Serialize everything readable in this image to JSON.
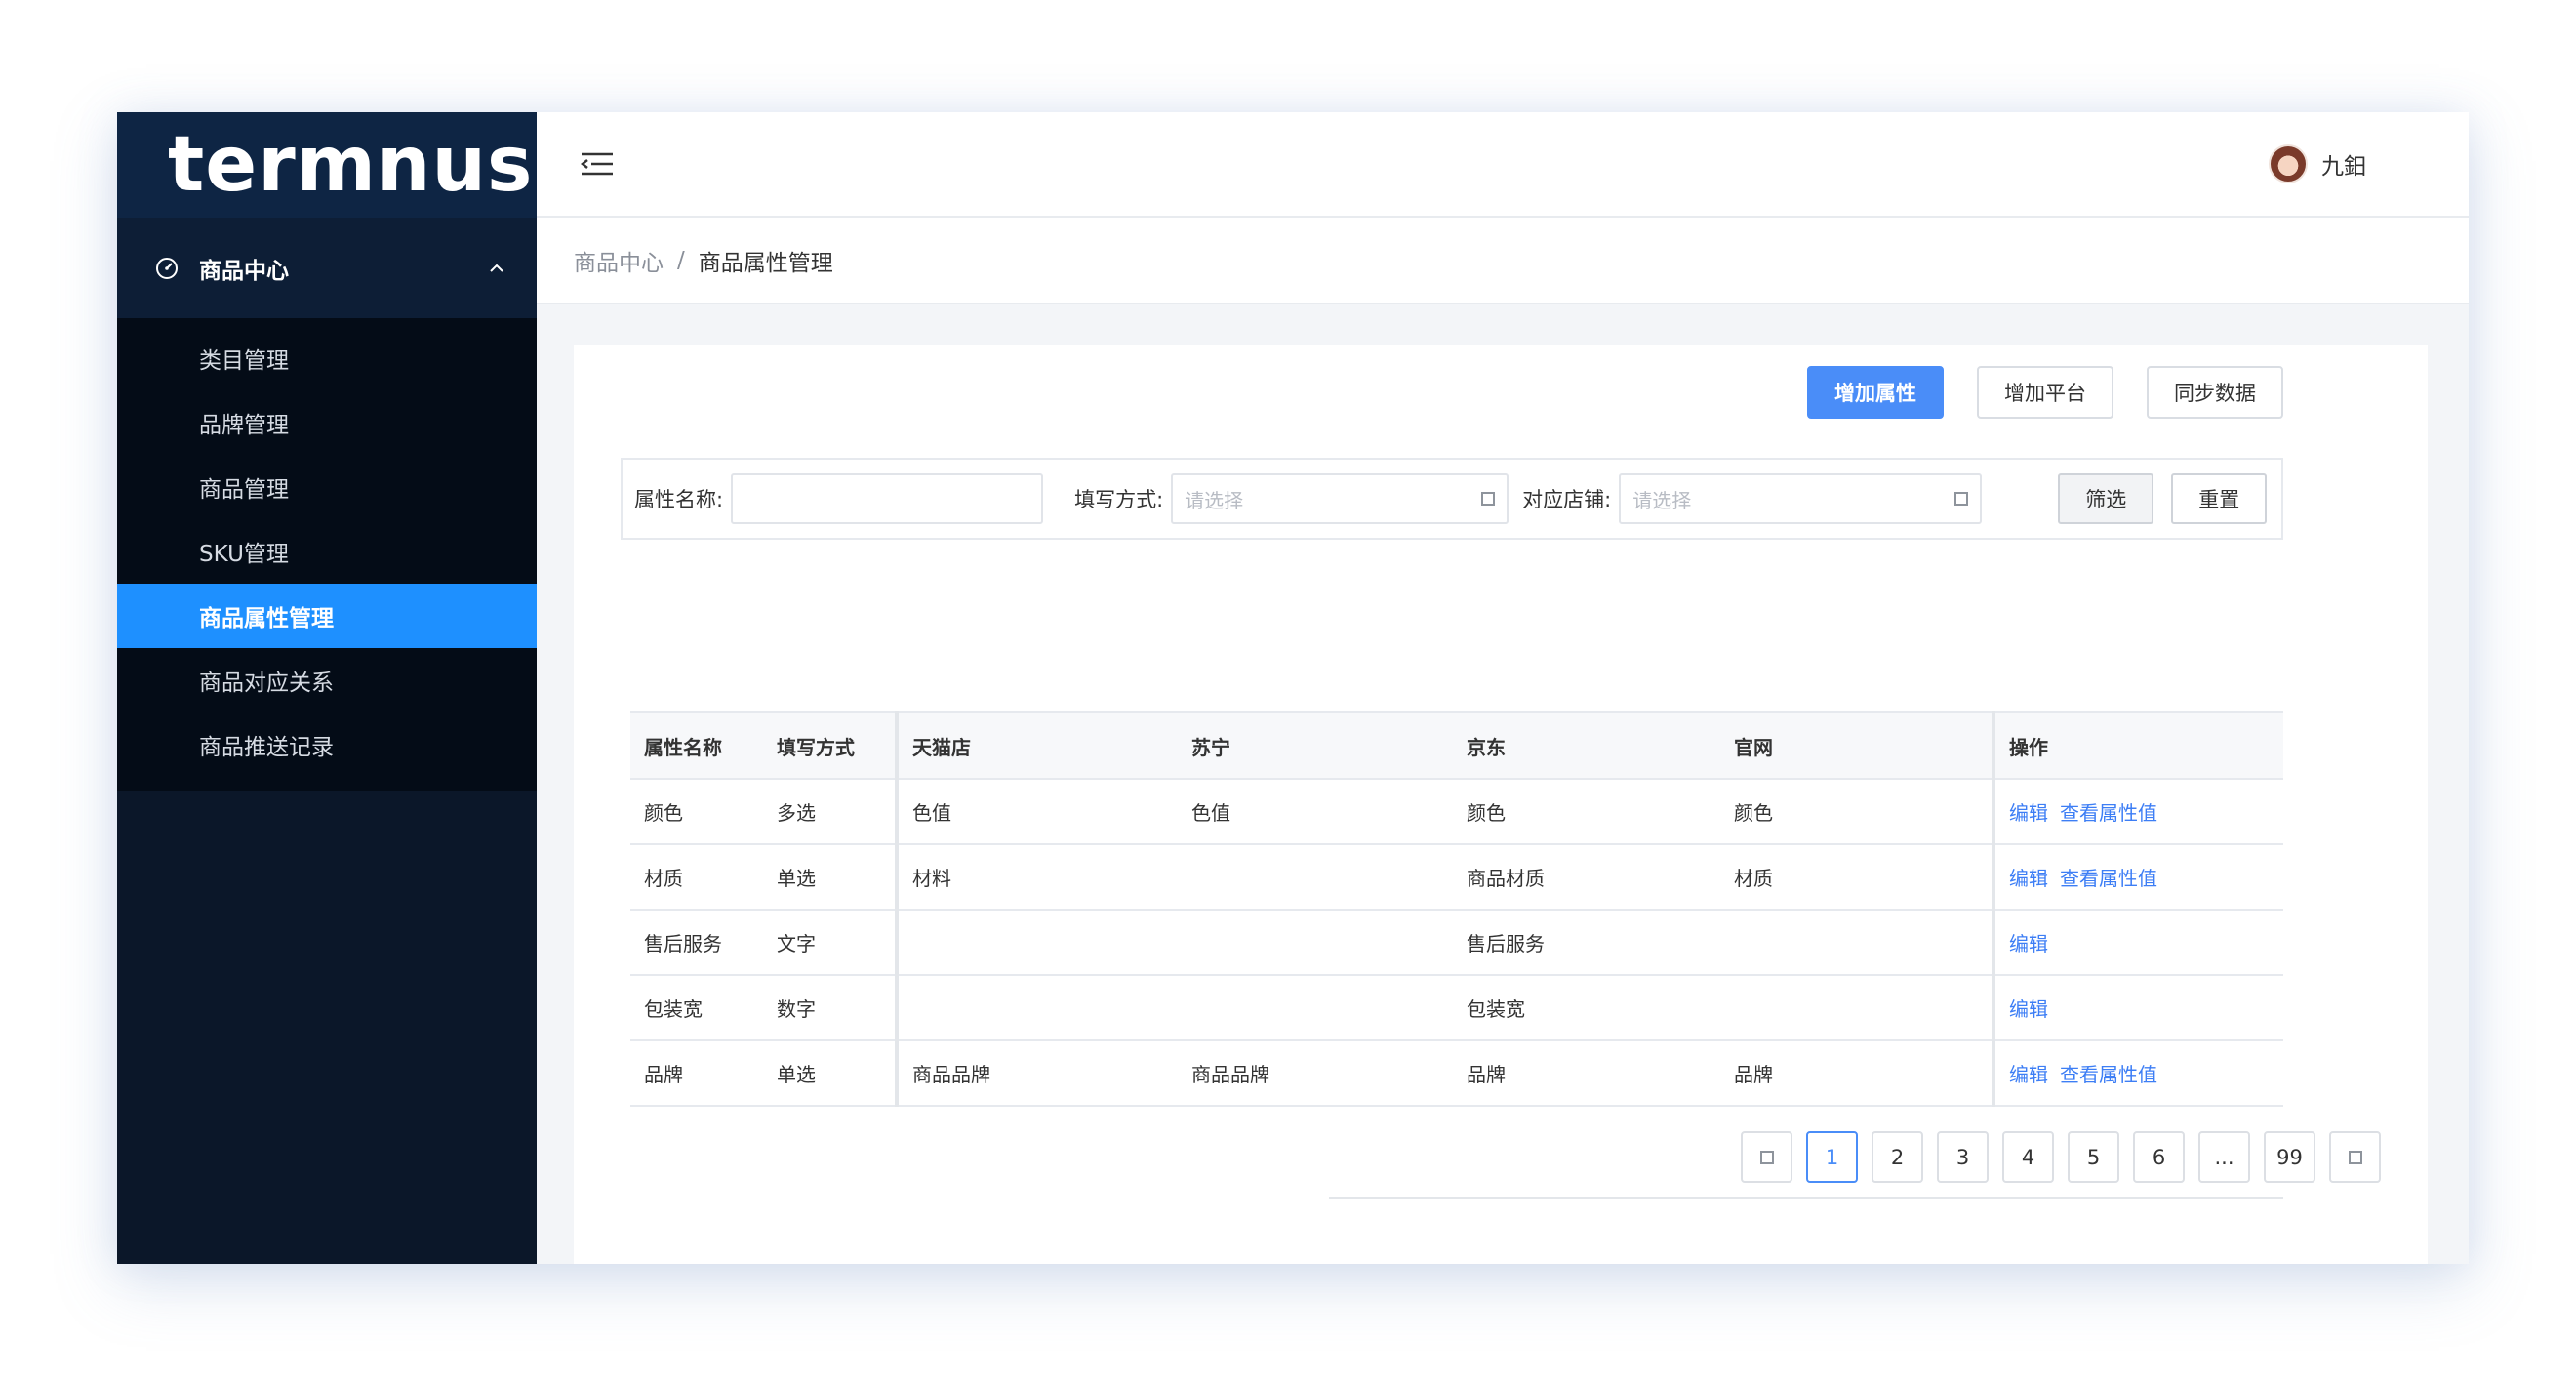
{
  "app": {
    "logo_text": "termnus"
  },
  "sidebar": {
    "group_label": "商品中心",
    "items": [
      {
        "label": "类目管理"
      },
      {
        "label": "品牌管理"
      },
      {
        "label": "商品管理"
      },
      {
        "label": "SKU管理"
      },
      {
        "label": "商品属性管理"
      },
      {
        "label": "商品对应关系"
      },
      {
        "label": "商品推送记录"
      }
    ],
    "active_index": 4
  },
  "header": {
    "user_name": "九鈤"
  },
  "breadcrumb": {
    "parent": "商品中心",
    "separator": "/",
    "current": "商品属性管理"
  },
  "toolbar": {
    "add_attr": "增加属性",
    "add_platform": "增加平台",
    "sync_data": "同步数据"
  },
  "filter": {
    "name_label": "属性名称:",
    "name_value": "",
    "method_label": "填写方式:",
    "method_placeholder": "请选择",
    "store_label": "对应店铺:",
    "store_placeholder": "请选择",
    "filter_btn": "筛选",
    "reset_btn": "重置"
  },
  "table": {
    "headers": [
      "属性名称",
      "填写方式",
      "天猫店",
      "苏宁",
      "京东",
      "官网",
      "操作"
    ],
    "rows": [
      {
        "cells": [
          "颜色",
          "多选",
          "色值",
          "色值",
          "颜色",
          "颜色"
        ],
        "actions": [
          "编辑",
          "查看属性值"
        ]
      },
      {
        "cells": [
          "材质",
          "单选",
          "材料",
          "",
          "商品材质",
          "材质"
        ],
        "actions": [
          "编辑",
          "查看属性值"
        ]
      },
      {
        "cells": [
          "售后服务",
          "文字",
          "",
          "",
          "售后服务",
          ""
        ],
        "actions": [
          "编辑"
        ]
      },
      {
        "cells": [
          "包装宽",
          "数字",
          "",
          "",
          "包装宽",
          ""
        ],
        "actions": [
          "编辑"
        ]
      },
      {
        "cells": [
          "品牌",
          "单选",
          "商品品牌",
          "商品品牌",
          "品牌",
          "品牌"
        ],
        "actions": [
          "编辑",
          "查看属性值"
        ]
      }
    ]
  },
  "pagination": {
    "pages": [
      "1",
      "2",
      "3",
      "4",
      "5",
      "6",
      "...",
      "99"
    ],
    "current": "1"
  },
  "colors": {
    "primary": "#4a8df8",
    "sidebar_bg": "#0b1729",
    "active_item": "#1e90ff",
    "link": "#3d7ef5"
  }
}
